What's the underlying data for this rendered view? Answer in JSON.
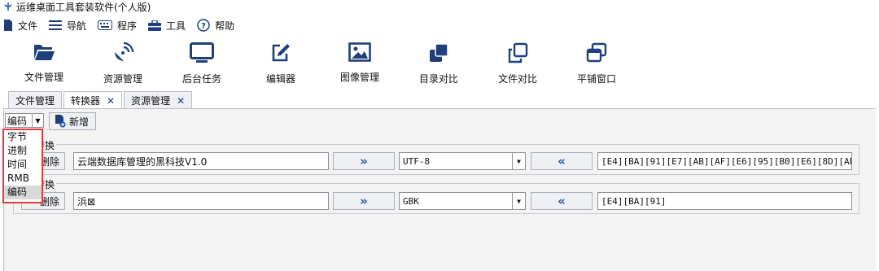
{
  "window": {
    "title": "运维桌面工具套装软件(个人版)"
  },
  "menu": {
    "file": "文件",
    "nav": "导航",
    "program": "程序",
    "tools": "工具",
    "help": "帮助"
  },
  "toolbar": {
    "file_mgr": "文件管理",
    "resource_mgr": "资源管理",
    "background_task": "后台任务",
    "editor": "编辑器",
    "image_mgr": "图像管理",
    "dir_compare": "目录对比",
    "file_compare": "文件对比",
    "tile_windows": "平铺窗口"
  },
  "tabs": {
    "file_mgr": "文件管理",
    "converter": "转换器",
    "resource_mgr": "资源管理",
    "close": "✕"
  },
  "converter": {
    "type_selected": "编码",
    "add_label": "新增",
    "dropdown_options": [
      "字节",
      "进制",
      "时间",
      "RMB",
      "编码"
    ],
    "rows": [
      {
        "legend": "转换",
        "delete_label": "删除",
        "input": "云端数据库管理的黑科技V1.0",
        "to_right": "»",
        "encoding": "UTF-8",
        "to_left": "«",
        "output": "[E4][BA][91][E7][AB][AF][E6][95][B0][E6][8D][AE][E"
      },
      {
        "legend": "转换",
        "delete_label": "删除",
        "input": "浜⊠",
        "to_right": "»",
        "encoding": "GBK",
        "to_left": "«",
        "output": "[E4][BA][91]"
      }
    ]
  }
}
